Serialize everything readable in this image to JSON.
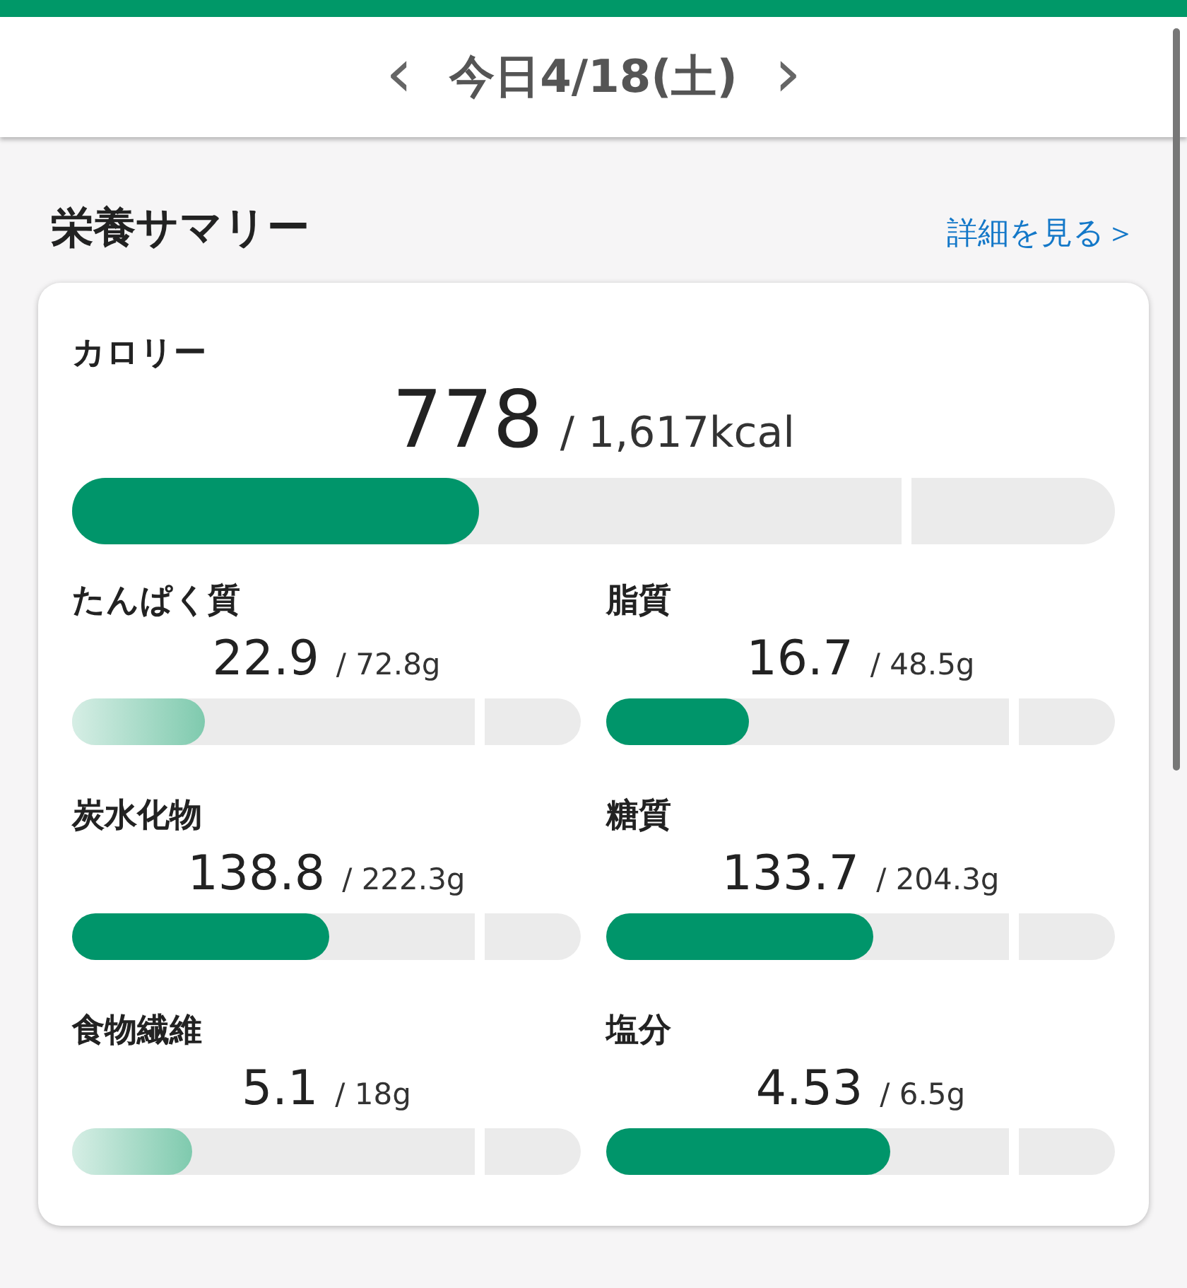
{
  "date_nav": {
    "prev": "‹",
    "label": "今日4/18(土)",
    "next": "›"
  },
  "summary": {
    "title": "栄養サマリー",
    "detail_link": "詳細を見る＞",
    "calorie": {
      "label": "カロリー",
      "value": "778",
      "target": "/ 1,617kcal",
      "level": 0.39
    },
    "nutrients": [
      {
        "label": "たんぱく質",
        "value": "22.9",
        "target": "/ 72.8g",
        "level": 0.26,
        "deficient": true
      },
      {
        "label": "脂質",
        "value": "16.7",
        "target": "/ 48.5g",
        "level": 0.28,
        "deficient": false
      },
      {
        "label": "炭水化物",
        "value": "138.8",
        "target": "/ 222.3g",
        "level": 0.505,
        "deficient": false
      },
      {
        "label": "糖質",
        "value": "133.7",
        "target": "/ 204.3g",
        "level": 0.525,
        "deficient": false
      },
      {
        "label": "食物繊維",
        "value": "5.1",
        "target": "/ 18g",
        "level": 0.236,
        "deficient": true
      },
      {
        "label": "塩分",
        "value": "4.53",
        "target": "/ 6.5g",
        "level": 0.558,
        "deficient": false
      }
    ]
  }
}
